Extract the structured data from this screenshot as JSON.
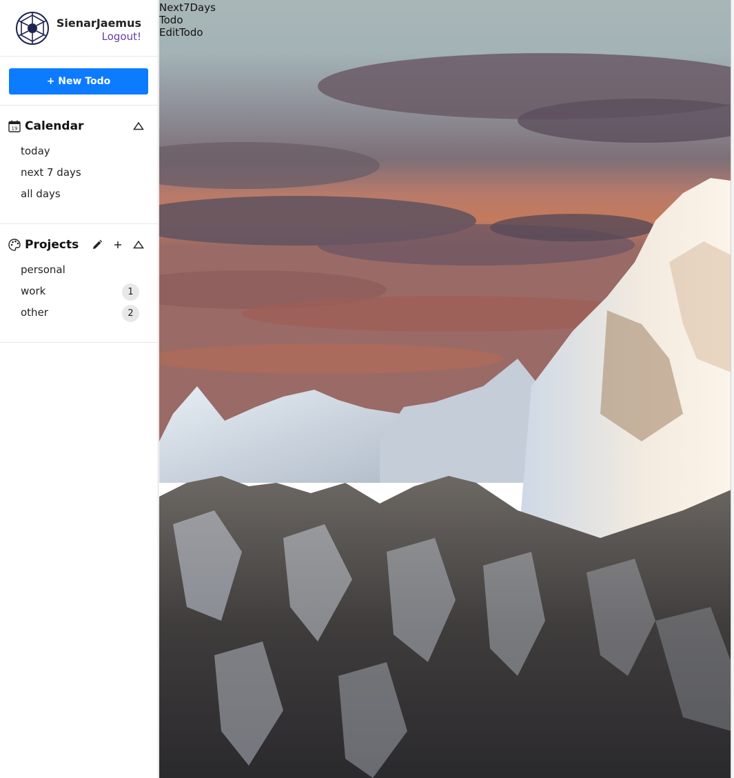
{
  "user": {
    "name": "SienarJaemus",
    "logout_label": "Logout!"
  },
  "actions": {
    "new_todo_label": "+ New Todo"
  },
  "calendar": {
    "title": "Calendar",
    "icon": "calendar-icon",
    "items": [
      {
        "label": "today"
      },
      {
        "label": "next 7 days"
      },
      {
        "label": "all days"
      }
    ]
  },
  "projects": {
    "title": "Projects",
    "icon": "palette-icon",
    "items": [
      {
        "label": "personal",
        "count": ""
      },
      {
        "label": "work",
        "count": "1"
      },
      {
        "label": "other",
        "count": "2"
      }
    ]
  },
  "routes": [
    "Next7Days",
    "Todo",
    "EditTodo"
  ],
  "colors": {
    "primary_button": "#0d7bff",
    "logout_link": "#6a3da0",
    "badge_bg": "#e8e8e8"
  }
}
